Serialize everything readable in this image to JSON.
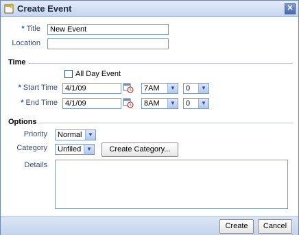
{
  "dialog": {
    "title": "Create Event",
    "close_label": "✕"
  },
  "fields": {
    "title": {
      "label": "Title",
      "value": "New Event",
      "required": "*"
    },
    "location": {
      "label": "Location",
      "value": ""
    }
  },
  "time": {
    "section_label": "Time",
    "all_day_label": "All Day Event",
    "start": {
      "label": "Start Time",
      "required": "*",
      "date": "4/1/09",
      "hour": "7AM",
      "minute": "0"
    },
    "end": {
      "label": "End Time",
      "required": "*",
      "date": "4/1/09",
      "hour": "8AM",
      "minute": "0"
    }
  },
  "options": {
    "section_label": "Options",
    "priority": {
      "label": "Priority",
      "value": "Normal"
    },
    "category": {
      "label": "Category",
      "value": "Unfiled",
      "create_label": "Create Category..."
    },
    "details": {
      "label": "Details",
      "value": ""
    }
  },
  "footer": {
    "create_label": "Create",
    "cancel_label": "Cancel"
  }
}
